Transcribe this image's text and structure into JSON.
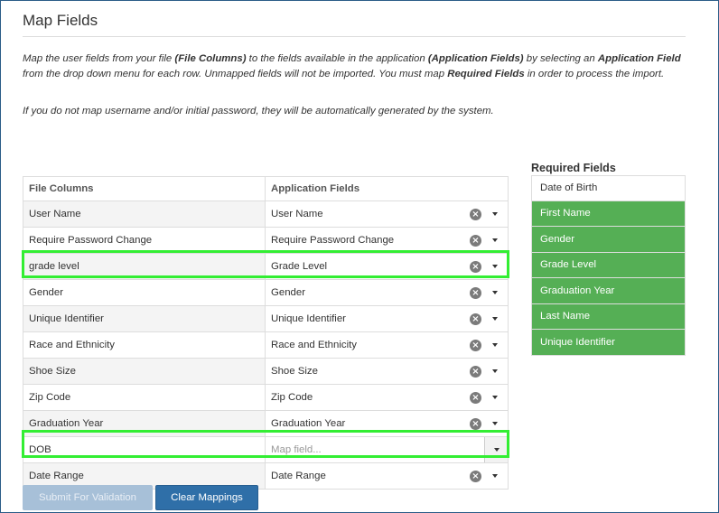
{
  "page": {
    "title": "Map Fields",
    "instructions": [
      [
        {
          "t": "Map the user fields from your file ",
          "b": false
        },
        {
          "t": "(File Columns)",
          "b": true
        },
        {
          "t": " to the fields available in the application ",
          "b": false
        },
        {
          "t": "(Application Fields)",
          "b": true
        },
        {
          "t": " by selecting an ",
          "b": false
        },
        {
          "t": "Application Field",
          "b": true
        },
        {
          "t": " from the drop down menu for each row. Unmapped fields will not be imported. You must map ",
          "b": false
        },
        {
          "t": "Required Fields",
          "b": true
        },
        {
          "t": " in order to process the import.",
          "b": false
        }
      ],
      [
        {
          "t": "If you do not map username and/or initial password, they will be automatically generated by the system.",
          "b": false
        }
      ]
    ]
  },
  "table": {
    "headers": {
      "file_columns": "File Columns",
      "application_fields": "Application Fields"
    },
    "placeholder": "Map field...",
    "rows": [
      {
        "file": "User Name",
        "field": "User Name",
        "highlight": false
      },
      {
        "file": "Require Password Change",
        "field": "Require Password Change",
        "highlight": false
      },
      {
        "file": "grade level",
        "field": "Grade Level",
        "highlight": true
      },
      {
        "file": "Gender",
        "field": "Gender",
        "highlight": false
      },
      {
        "file": "Unique Identifier",
        "field": "Unique Identifier",
        "highlight": false
      },
      {
        "file": "Race and Ethnicity",
        "field": "Race and Ethnicity",
        "highlight": false
      },
      {
        "file": "Shoe Size",
        "field": "Shoe Size",
        "highlight": false
      },
      {
        "file": "Zip Code",
        "field": "Zip Code",
        "highlight": false
      },
      {
        "file": "Graduation Year",
        "field": "Graduation Year",
        "highlight": false
      },
      {
        "file": "DOB",
        "field": "",
        "highlight": true
      },
      {
        "file": "Date Range",
        "field": "Date Range",
        "highlight": false
      }
    ]
  },
  "buttons": {
    "submit": "Submit For Validation",
    "clear": "Clear Mappings"
  },
  "required": {
    "title": "Required Fields",
    "items": [
      {
        "label": "Date of Birth",
        "mapped": false
      },
      {
        "label": "First Name",
        "mapped": true
      },
      {
        "label": "Gender",
        "mapped": true
      },
      {
        "label": "Grade Level",
        "mapped": true
      },
      {
        "label": "Graduation Year",
        "mapped": true
      },
      {
        "label": "Last Name",
        "mapped": true
      },
      {
        "label": "Unique Identifier",
        "mapped": true
      }
    ]
  },
  "icons": {
    "clear": "clear-circle-x-icon",
    "dropdown": "caret-down-icon"
  },
  "colors": {
    "mapped_required": "#55af55",
    "highlight_border": "#33ee33",
    "primary_button": "#2f6fa8",
    "disabled_button": "#a7c0d8"
  }
}
